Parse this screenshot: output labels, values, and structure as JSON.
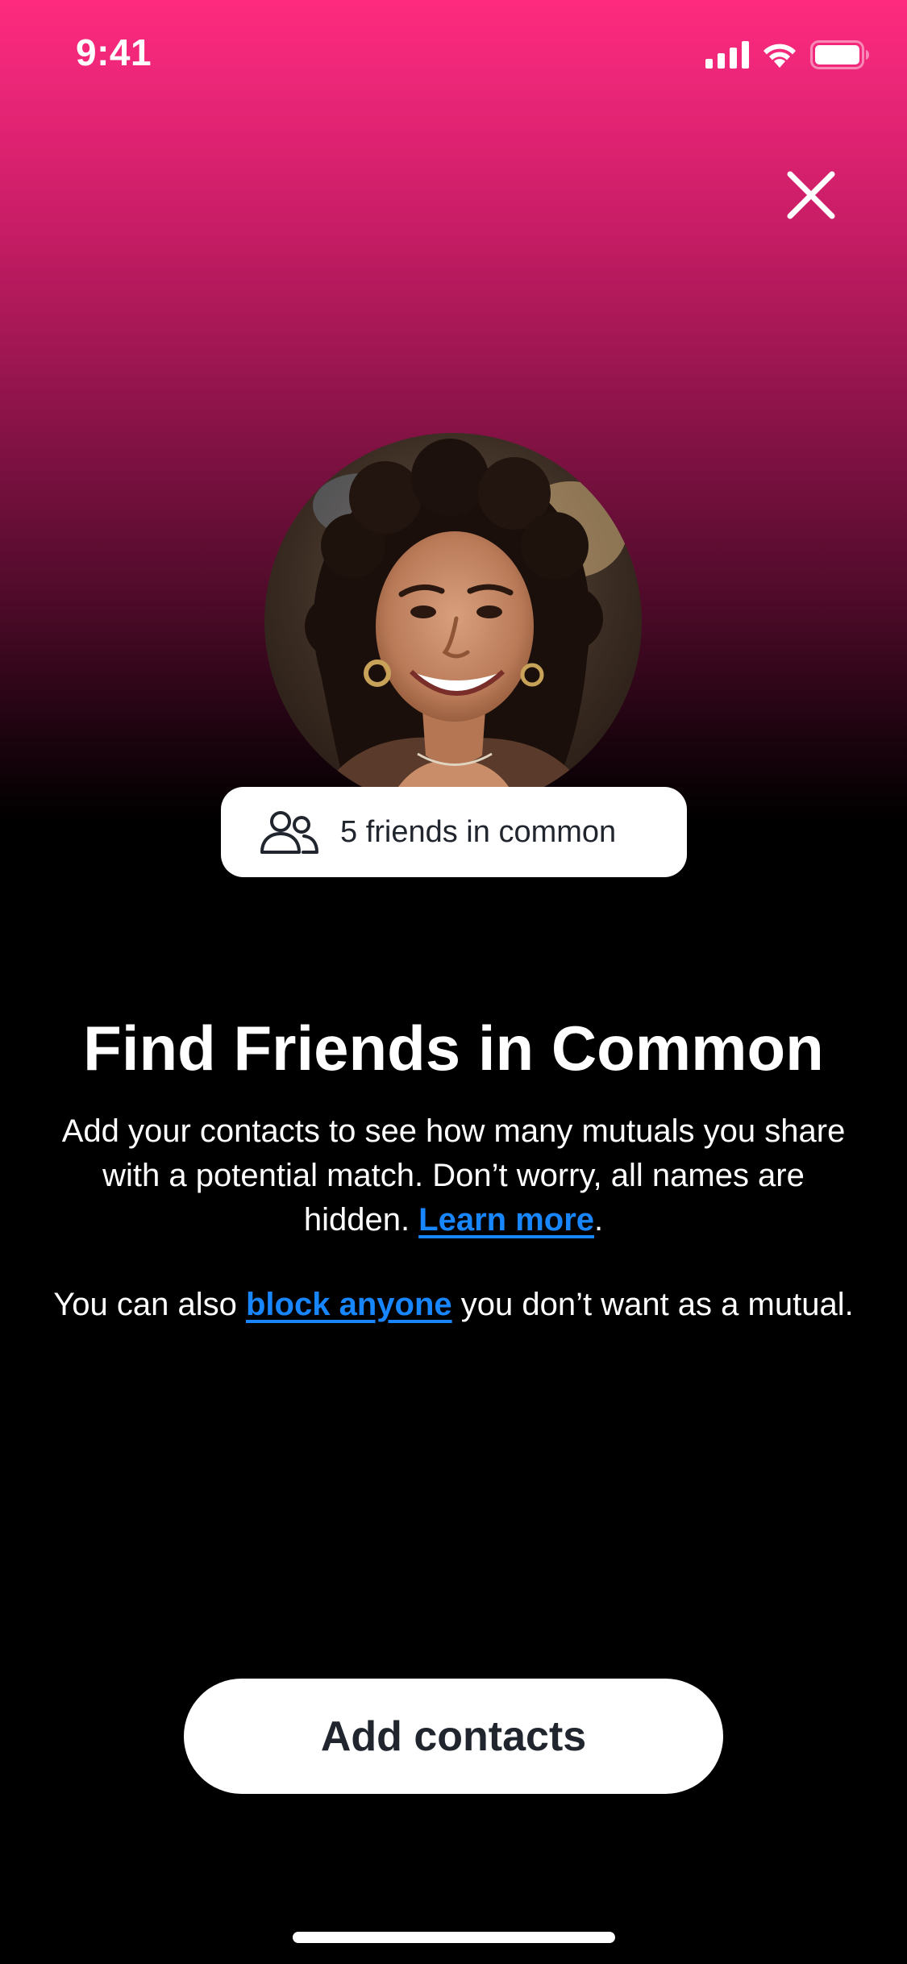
{
  "status_bar": {
    "time": "9:41",
    "icons": [
      "cellular-signal-icon",
      "wifi-icon",
      "battery-icon"
    ]
  },
  "close_icon": "close-icon",
  "profile": {
    "avatar_icon": "profile-photo",
    "friends_pill": {
      "icon": "friends-icon",
      "label": "5 friends in common"
    }
  },
  "content": {
    "title": "Find Friends in Common",
    "paragraph_1": {
      "text": "Add your contacts to see how many mutuals you share with a potential match. Don’t worry, all names are hidden. ",
      "link": "Learn more",
      "suffix": "."
    },
    "paragraph_2": {
      "prefix": "You can also ",
      "link": "block anyone",
      "suffix": " you don’t want as a mutual."
    }
  },
  "actions": {
    "primary_label": "Add contacts"
  },
  "colors": {
    "gradient_top": "#fe2a7d",
    "background": "#000000",
    "link": "#1786ff",
    "button_bg": "#ffffff",
    "button_text": "#21262e"
  }
}
